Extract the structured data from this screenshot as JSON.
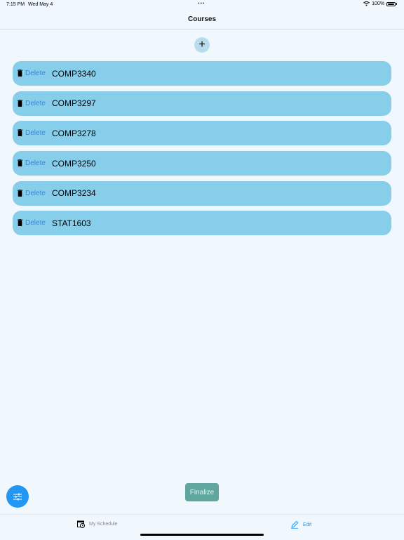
{
  "status_bar": {
    "time": "7:15 PM",
    "date": "Wed May 4",
    "dots": "•••",
    "battery": "100%"
  },
  "nav": {
    "title": "Courses"
  },
  "add_button": {
    "label": "+"
  },
  "courses": [
    {
      "delete_label": "Delete",
      "name": "COMP3340"
    },
    {
      "delete_label": "Delete",
      "name": "COMP3297"
    },
    {
      "delete_label": "Delete",
      "name": "COMP3278"
    },
    {
      "delete_label": "Delete",
      "name": "COMP3250"
    },
    {
      "delete_label": "Delete",
      "name": "COMP3234"
    },
    {
      "delete_label": "Delete",
      "name": "STAT1603"
    }
  ],
  "finalize": {
    "label": "Finalize"
  },
  "tabs": [
    {
      "label": "My Schedule",
      "icon": "schedule-icon",
      "selected": false
    },
    {
      "label": "Edit",
      "icon": "pencil-icon",
      "selected": true
    }
  ],
  "colors": {
    "row_bg": "#87ceeb",
    "accent": "#2196f3",
    "finalize_bg": "#5fa69e",
    "background": "#f0f7fd"
  }
}
